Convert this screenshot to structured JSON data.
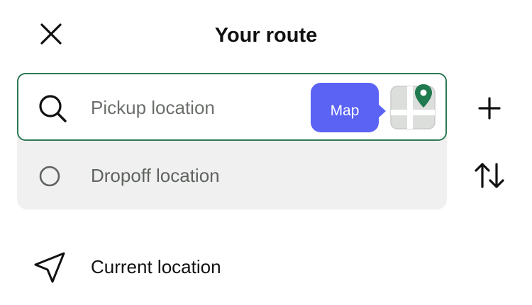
{
  "header": {
    "title": "Your route",
    "close_icon": "close-icon"
  },
  "route": {
    "pickup": {
      "value": "",
      "placeholder": "Pickup location",
      "icon": "search-icon",
      "border_color": "#2b7a55"
    },
    "map_tooltip": {
      "label": "Map",
      "color": "#5b63f5"
    },
    "map_thumbnail": {
      "icon": "map-pin-icon",
      "pin_color": "#1f7a4f"
    },
    "dropoff": {
      "value": "",
      "placeholder": "Dropoff location",
      "icon": "circle-icon"
    }
  },
  "actions": {
    "add_stop_icon": "plus-icon",
    "swap_icon": "swap-vertical-icon"
  },
  "suggestions": [
    {
      "label": "Current location",
      "icon": "navigation-arrow-icon"
    }
  ]
}
